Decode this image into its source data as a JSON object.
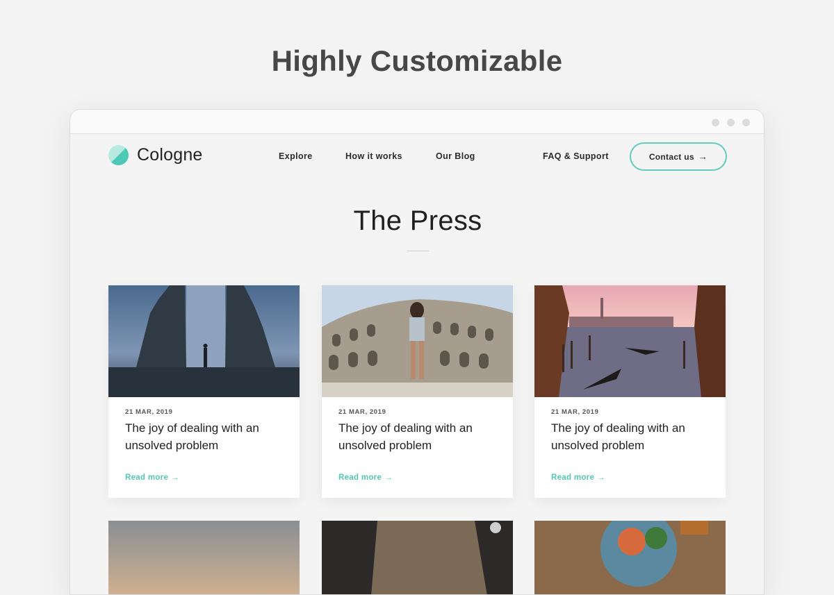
{
  "headline": "Highly Customizable",
  "brand": {
    "name": "Cologne",
    "accent": "#4cc9b5"
  },
  "nav": {
    "links": [
      "Explore",
      "How it works",
      "Our Blog",
      "FAQ & Support"
    ],
    "cta_label": "Contact us",
    "cta_icon": "arrow-right-icon"
  },
  "section": {
    "title": "The Press"
  },
  "posts": [
    {
      "date": "21 MAR, 2019",
      "title": "The joy of dealing with an unsolved problem",
      "link": "Read more"
    },
    {
      "date": "21 MAR, 2019",
      "title": "The joy of dealing with an unsolved problem",
      "link": "Read more"
    },
    {
      "date": "21 MAR, 2019",
      "title": "The joy of dealing with an unsolved problem",
      "link": "Read more"
    }
  ]
}
